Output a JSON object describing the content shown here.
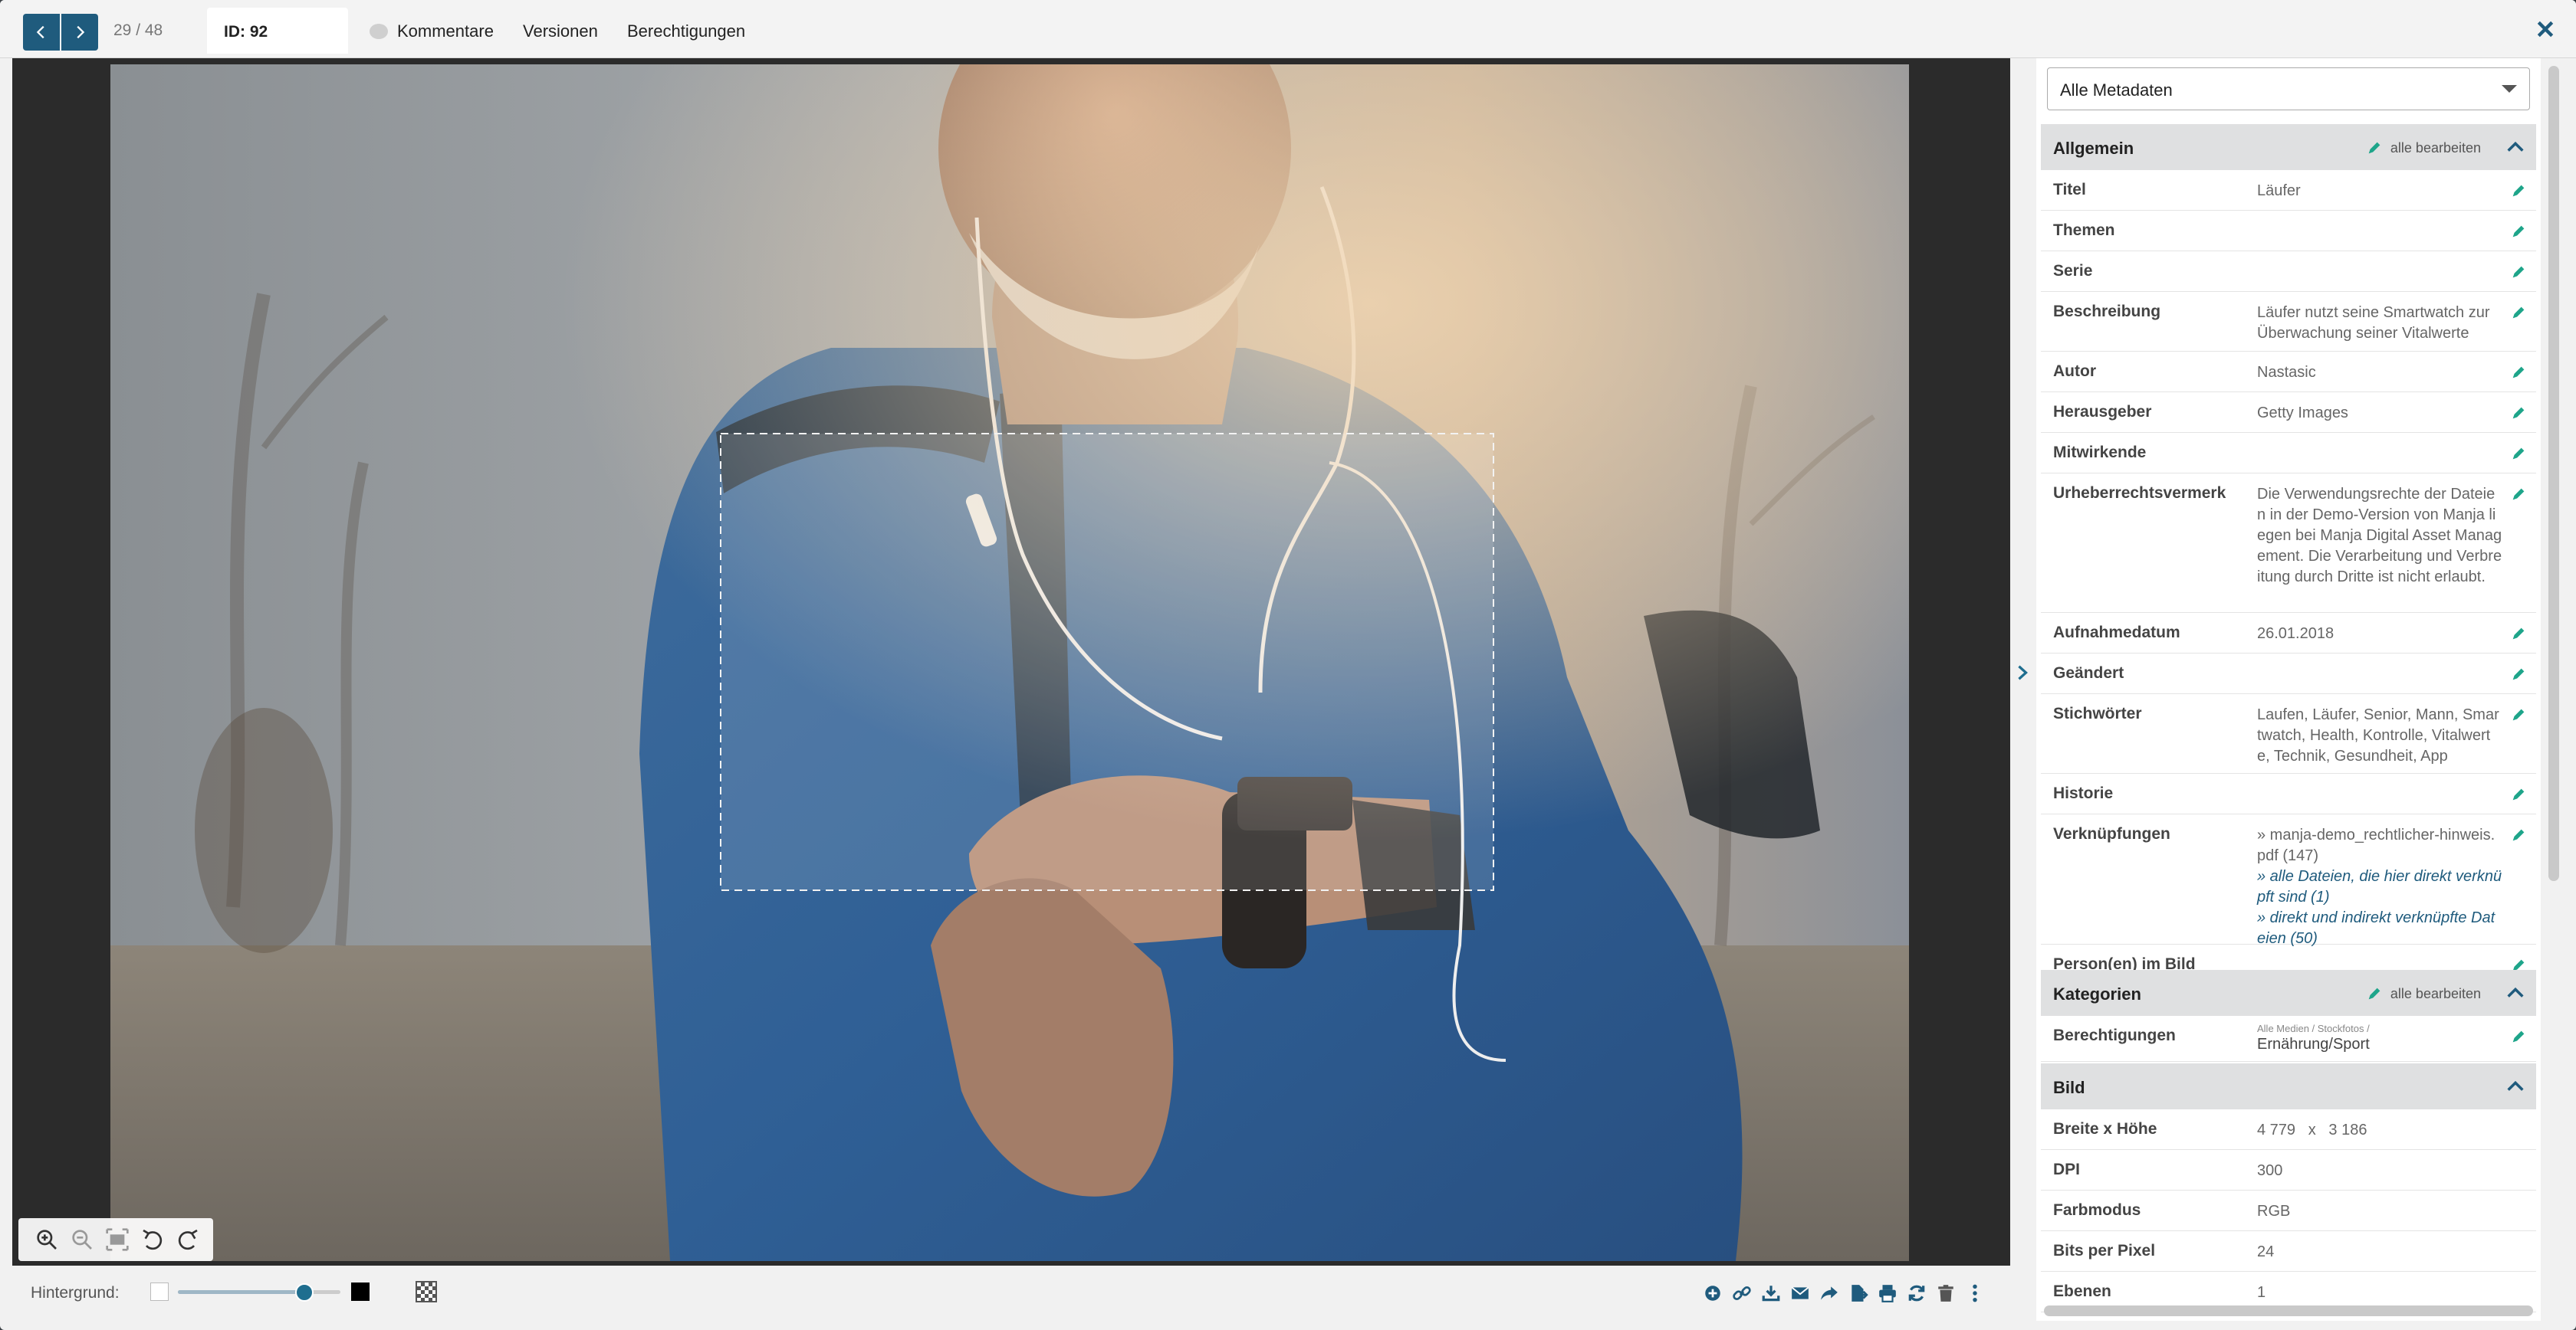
{
  "header": {
    "counter": "29 / 48",
    "id_label": "ID: 92",
    "tabs": {
      "comments": "Kommentare",
      "versions": "Versionen",
      "permissions": "Berechtigungen"
    }
  },
  "bottom": {
    "background_label": "Hintergrund:",
    "background_slider_fraction": 0.78
  },
  "meta": {
    "select_value": "Alle Metadaten",
    "edit_all": "alle bearbeiten",
    "sections": {
      "general": "Allgemein",
      "categories": "Kategorien",
      "image": "Bild"
    },
    "general_rows": {
      "title": {
        "label": "Titel",
        "value": "Läufer"
      },
      "topics": {
        "label": "Themen",
        "value": ""
      },
      "series": {
        "label": "Serie",
        "value": ""
      },
      "description": {
        "label": "Beschreibung",
        "value": "Läufer nutzt seine Smartwatch zur Überwachung seiner Vitalwerte"
      },
      "author": {
        "label": "Autor",
        "value": "Nastasic"
      },
      "publisher": {
        "label": "Herausgeber",
        "value": "Getty Images"
      },
      "contributors": {
        "label": "Mitwirkende",
        "value": ""
      },
      "copyright": {
        "label": "Urheberrechtsvermerk",
        "value": "Die Verwendungsrechte der Dateien in der Demo-Version von Manja liegen bei Manja Digital Asset Management. Die Verarbeitung und Verbreitung durch Dritte ist nicht erlaubt."
      },
      "capture_date": {
        "label": "Aufnahmedatum",
        "value": "26.01.2018"
      },
      "modified": {
        "label": "Geändert",
        "value": ""
      },
      "keywords": {
        "label": "Stichwörter",
        "value": "Laufen, Läufer, Senior, Mann, Smartwatch, Health, Kontrolle, Vitalwerte, Technik, Gesundheit, App"
      },
      "history": {
        "label": "Historie",
        "value": ""
      },
      "links": {
        "label": "Verknüpfungen",
        "file": "» manja-demo_rechtlicher-hinweis.pdf (147)",
        "direct": "» alle Dateien, die hier direkt verknüpft sind (1)",
        "indirect": "» direkt und indirekt verknüpfte Dateien (50)"
      },
      "persons": {
        "label": "Person(en) im Bild",
        "value": ""
      }
    },
    "category_rows": {
      "permissions": {
        "label": "Berechtigungen",
        "path": "Alle Medien / Stockfotos /",
        "value": "Ernährung/Sport"
      }
    },
    "image_rows": {
      "dimensions": {
        "label": "Breite x Höhe",
        "value": "4 779   x   3 186"
      },
      "dpi": {
        "label": "DPI",
        "value": "300"
      },
      "color_mode": {
        "label": "Farbmodus",
        "value": "RGB"
      },
      "bits": {
        "label": "Bits per Pixel",
        "value": "24"
      },
      "layers": {
        "label": "Ebenen",
        "value": "1"
      }
    }
  },
  "colors": {
    "accent": "#1f5b7d",
    "edit_green": "#1ea58a"
  }
}
